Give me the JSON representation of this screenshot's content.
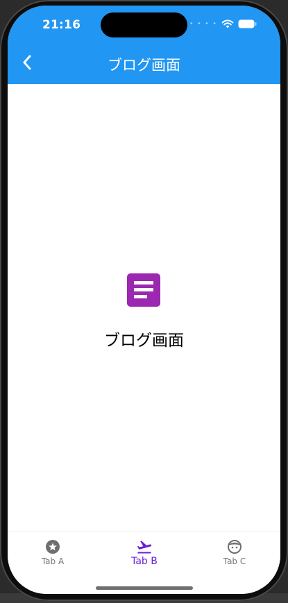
{
  "status_bar": {
    "time": "21:16",
    "signal_icon": "cellular-dots-icon",
    "wifi_icon": "wifi-icon",
    "battery_icon": "battery-icon"
  },
  "app_bar": {
    "back_icon": "chevron-left-icon",
    "title": "ブログ画面",
    "background_color": "#2196f3"
  },
  "content": {
    "icon": "article-icon",
    "icon_color": "#9c27b0",
    "text": "ブログ画面"
  },
  "bottom_nav": {
    "selected_color": "#6a1fd1",
    "unselected_color": "#757575",
    "tabs": [
      {
        "label": "Tab A",
        "icon": "stars-icon",
        "selected": false
      },
      {
        "label": "Tab B",
        "icon": "flight-takeoff-icon",
        "selected": true
      },
      {
        "label": "Tab C",
        "icon": "face-icon",
        "selected": false
      }
    ]
  }
}
